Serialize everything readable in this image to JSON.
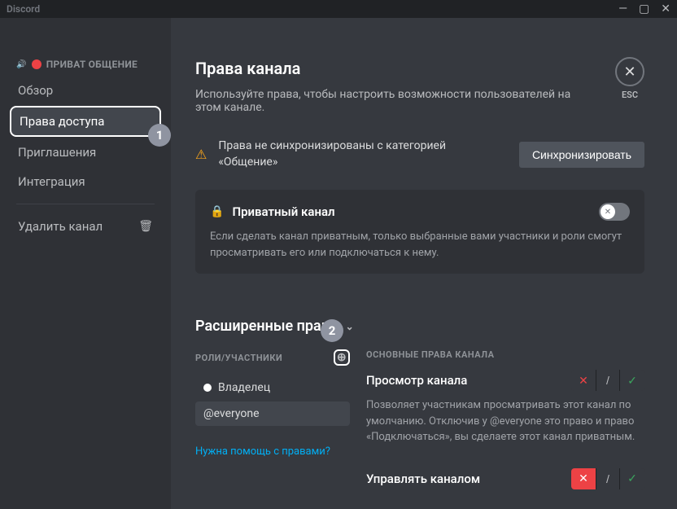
{
  "app_title": "Discord",
  "close_label": "ESC",
  "sidebar": {
    "channel_name": "ПРИВАТ ОБЩЕНИЕ",
    "items": [
      {
        "label": "Обзор"
      },
      {
        "label": "Права доступа"
      },
      {
        "label": "Приглашения"
      },
      {
        "label": "Интеграция"
      }
    ],
    "delete_label": "Удалить канал"
  },
  "annotations": {
    "step1": "1",
    "step2": "2"
  },
  "main": {
    "title": "Права канала",
    "subtitle": "Используйте права, чтобы настроить возможности пользователей на этом канале.",
    "sync": {
      "text": "Права не синхронизированы с категорией «Общение»",
      "button": "Синхронизировать"
    },
    "private": {
      "title": "Приватный канал",
      "desc": "Если сделать канал приватным, только выбранные вами участники и роли смогут просматривать его или подключаться к нему."
    },
    "advanced_title": "Расширенные права",
    "roles_header": "РОЛИ/УЧАСТНИКИ",
    "perms_header": "ОСНОВНЫЕ ПРАВА КАНАЛА",
    "roles": [
      {
        "name": "Владелец"
      },
      {
        "name": "@everyone"
      }
    ],
    "help_link": "Нужна помощь с правами?",
    "permissions": [
      {
        "title": "Просмотр канала",
        "desc": "Позволяет участникам просматривать этот канал по умолчанию. Отключив у @everyone это право и право «Подключаться», вы сделаете этот канал приватным.",
        "active": "neutral"
      },
      {
        "title": "Управлять каналом",
        "desc": "",
        "active": "deny"
      }
    ]
  }
}
